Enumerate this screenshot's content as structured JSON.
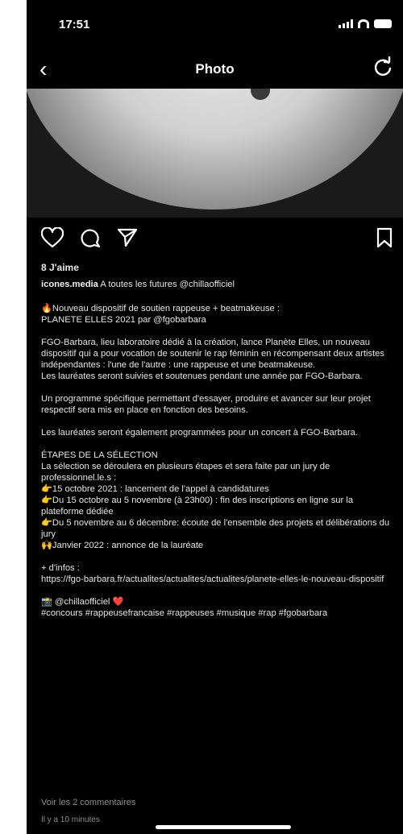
{
  "status": {
    "time": "17:51"
  },
  "nav": {
    "title": "Photo"
  },
  "post": {
    "likes": "8 J'aime",
    "username": "icones.media",
    "caption_first": "A toutes les futures @chillaofficiel",
    "p1": "🔥Nouveau dispositif de soutien rappeuse + beatmakeuse :\nPLANETE ELLES 2021 par @fgobarbara",
    "p2": "FGO-Barbara, lieu laboratoire dédié à la création, lance Planète Elles, un nouveau dispositif qui a pour vocation de soutenir le rap féminin en récompensant deux artistes indépendantes : l'une de l'autre : une rappeuse et une beatmakeuse.\nLes lauréates seront suivies et soutenues pendant une année par FGO-Barbara.",
    "p3": "Un programme spécifique permettant d'essayer, produire et avancer sur leur projet respectif sera mis en place en fonction des besoins.",
    "p4": "Les lauréates seront également programmées pour un concert à FGO-Barbara.",
    "p5": "ÉTAPES DE LA SÉLECTION\nLa sélection se déroulera en plusieurs étapes et sera faite par un jury de professionnel.le.s :\n👉15 octobre 2021 : lancement de l'appel à candidatures\n👉Du 15 octobre au 5 novembre (à 23h00) : fin des inscriptions en ligne sur la plateforme dédiée\n👉Du 5 novembre au 6 décembre: écoute de l'ensemble des projets et délibérations du jury\n🙌Janvier 2022 : annonce de la lauréate",
    "p6": "+ d'infos :\nhttps://fgo-barbara.fr/actualites/actualites/actualites/planete-elles-le-nouveau-dispositif",
    "p7": "📸 @chillaofficiel ❤️\n#concours #rappeusefrancaise #rappeuses #musique #rap #fgobarbara",
    "view_comments": "Voir les 2 commentaires",
    "time_ago": "Il y a 10 minutes"
  }
}
